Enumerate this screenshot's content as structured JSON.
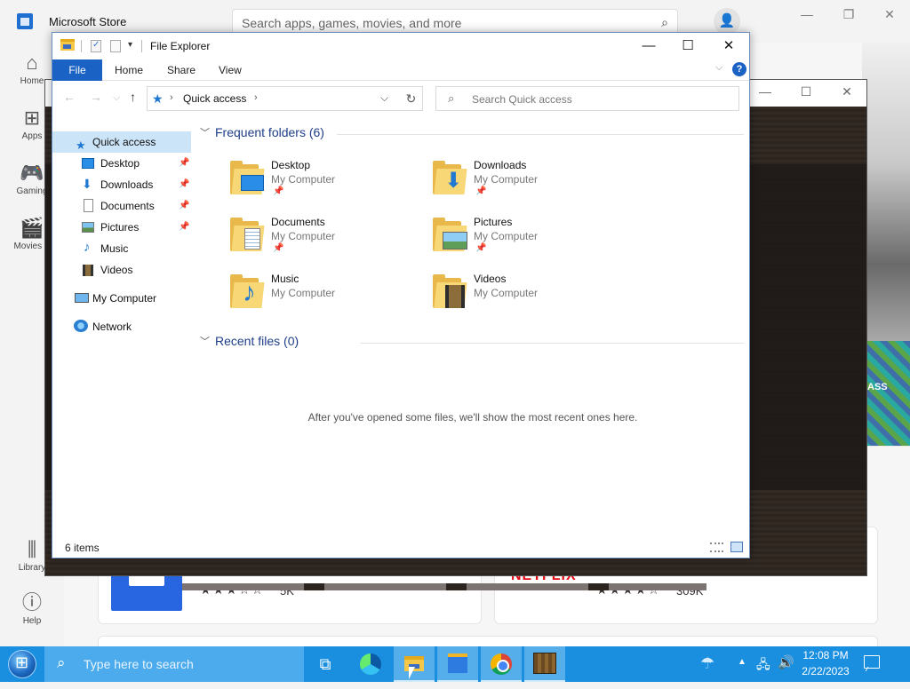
{
  "store": {
    "app_title": "Microsoft Store",
    "search_placeholder": "Search apps, games, movies, and more",
    "nav": [
      {
        "label": "Home",
        "icon": "home-icon"
      },
      {
        "label": "Apps",
        "icon": "apps-icon"
      },
      {
        "label": "Gaming",
        "icon": "gaming-icon"
      },
      {
        "label": "Movies &",
        "icon": "movies-icon"
      },
      {
        "label": "Library",
        "icon": "library-icon"
      },
      {
        "label": "Help",
        "icon": "help-icon"
      }
    ],
    "hero_text": "ASS",
    "cards": [
      {
        "stars": "★★★☆☆",
        "count": "5K"
      },
      {
        "logo": "NETFLIX",
        "stars": "★★★★☆",
        "count": "309K"
      }
    ]
  },
  "explorer": {
    "title": "File Explorer",
    "ribbon": {
      "file": "File",
      "tabs": [
        "Home",
        "Share",
        "View"
      ],
      "help": "?"
    },
    "address": {
      "location": "Quick access"
    },
    "search_placeholder": "Search Quick access",
    "nav_pane": [
      {
        "label": "Quick access",
        "icon": "star-icon",
        "selected": true
      },
      {
        "label": "Desktop",
        "icon": "desktop-icon",
        "pinned": true
      },
      {
        "label": "Downloads",
        "icon": "downloads-icon",
        "pinned": true
      },
      {
        "label": "Documents",
        "icon": "documents-icon",
        "pinned": true
      },
      {
        "label": "Pictures",
        "icon": "pictures-icon",
        "pinned": true
      },
      {
        "label": "Music",
        "icon": "music-icon"
      },
      {
        "label": "Videos",
        "icon": "videos-icon"
      },
      {
        "label": "My Computer",
        "icon": "computer-icon"
      },
      {
        "label": "Network",
        "icon": "network-icon"
      }
    ],
    "frequent_header": "Frequent folders (6)",
    "frequent": [
      {
        "name": "Desktop",
        "location": "My Computer",
        "pinned": true,
        "icon": "desktop-folder-icon"
      },
      {
        "name": "Downloads",
        "location": "My Computer",
        "pinned": true,
        "icon": "downloads-folder-icon"
      },
      {
        "name": "Documents",
        "location": "My Computer",
        "pinned": true,
        "icon": "documents-folder-icon"
      },
      {
        "name": "Pictures",
        "location": "My Computer",
        "pinned": true,
        "icon": "pictures-folder-icon"
      },
      {
        "name": "Music",
        "location": "My Computer",
        "pinned": false,
        "icon": "music-folder-icon"
      },
      {
        "name": "Videos",
        "location": "My Computer",
        "pinned": false,
        "icon": "videos-folder-icon"
      }
    ],
    "recent_header": "Recent files (0)",
    "recent_empty": "After you've opened some files, we'll show the most recent ones here.",
    "status": "6 items"
  },
  "taskbar": {
    "search_placeholder": "Type here to search",
    "time": "12:08 PM",
    "date": "2/22/2023"
  },
  "colors": {
    "accent": "#1a63c4",
    "taskbar": "#1a8fe0",
    "selected": "#cce4f7",
    "folder": "#f8d776"
  }
}
